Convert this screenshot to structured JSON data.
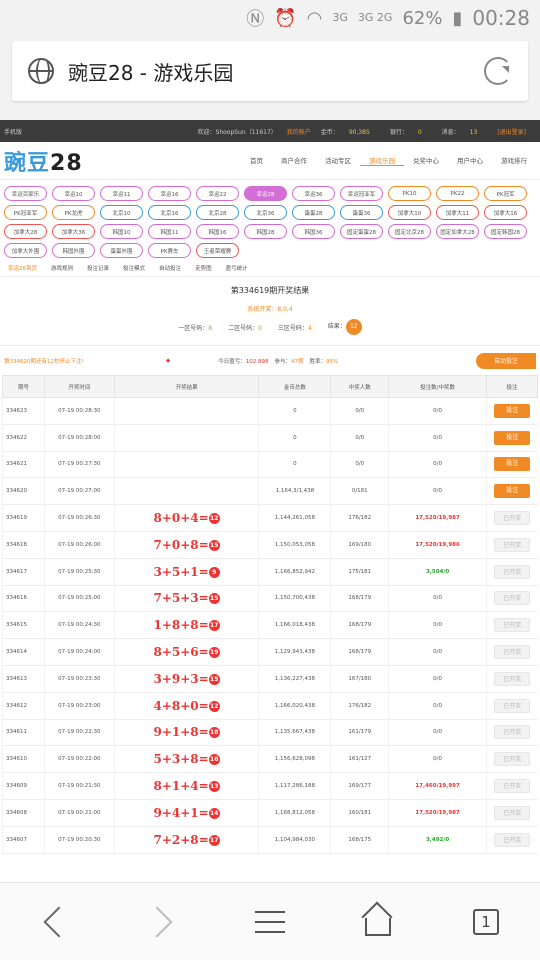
{
  "status": {
    "net1": "3G",
    "net2": "3G 2G",
    "battery": "62%",
    "time": "00:28"
  },
  "browser": {
    "title": "豌豆28 - 游戏乐园",
    "tabs_count": "1"
  },
  "topbar": {
    "left": "手机版",
    "user": "欢迎：ShoopSun（11617）",
    "my_account": "我的账户",
    "gold_label": "金币：",
    "gold_value": "90,385",
    "bank_label": "银行：",
    "bank_value": "0",
    "msg_label": "消息：",
    "msg_value": "13",
    "logout": "[退出登录]"
  },
  "logo": {
    "a": "豌豆",
    "b": "28"
  },
  "nav": [
    "首页",
    "商户合作",
    "活动专区",
    "游戏乐园",
    "兑奖中心",
    "用户中心",
    "游戏排行"
  ],
  "game_tags": [
    {
      "label": "幸运百家乐",
      "c": "p"
    },
    {
      "label": "幸运10",
      "c": "p"
    },
    {
      "label": "幸运11",
      "c": "p"
    },
    {
      "label": "幸运16",
      "c": "p"
    },
    {
      "label": "幸运22",
      "c": "p"
    },
    {
      "label": "幸运28",
      "c": "active"
    },
    {
      "label": "幸运36",
      "c": "p"
    },
    {
      "label": "幸运冠亚军",
      "c": "p"
    },
    {
      "label": "PK10",
      "c": "o"
    },
    {
      "label": "PK22",
      "c": "o"
    },
    {
      "label": "PK冠军",
      "c": "o"
    },
    {
      "label": "PK冠亚军",
      "c": "o"
    },
    {
      "label": "PK龙虎",
      "c": "o"
    },
    {
      "label": "北京10",
      "c": "b"
    },
    {
      "label": "北京16",
      "c": "b"
    },
    {
      "label": "北京28",
      "c": "b"
    },
    {
      "label": "北京36",
      "c": "b"
    },
    {
      "label": "蛋蛋28",
      "c": "b"
    },
    {
      "label": "蛋蛋36",
      "c": "b"
    },
    {
      "label": "加拿大10",
      "c": "r"
    },
    {
      "label": "加拿大11",
      "c": "r"
    },
    {
      "label": "加拿大16",
      "c": "r"
    },
    {
      "label": "加拿大28",
      "c": "r"
    },
    {
      "label": "加拿大36",
      "c": "r"
    },
    {
      "label": "韩国10",
      "c": "p"
    },
    {
      "label": "韩国11",
      "c": "p"
    },
    {
      "label": "韩国16",
      "c": "p"
    },
    {
      "label": "韩国28",
      "c": "p"
    },
    {
      "label": "韩国36",
      "c": "p"
    },
    {
      "label": "固定蛋蛋28",
      "c": "p"
    },
    {
      "label": "固定北京28",
      "c": "p"
    },
    {
      "label": "固定加拿大28",
      "c": "p"
    },
    {
      "label": "固定韩国28",
      "c": "p"
    },
    {
      "label": "加拿大外围",
      "c": "p"
    },
    {
      "label": "韩国外围",
      "c": "p"
    },
    {
      "label": "蛋蛋外围",
      "c": "p"
    },
    {
      "label": "PK赛车",
      "c": "p"
    },
    {
      "label": "王者荣耀赛",
      "c": "r"
    }
  ],
  "subtabs": [
    "幸运28首页",
    "游戏规则",
    "投注记录",
    "投注模式",
    "自动投注",
    "走势图",
    "盈亏统计"
  ],
  "result": {
    "title": "第334619期开奖结果",
    "status": "系统开奖：8,0,4",
    "zone1_label": "一区号码：",
    "zone1": "8",
    "zone2_label": "二区号码：",
    "zone2": "0",
    "zone3_label": "三区号码：",
    "zone3": "4",
    "result_label": "结果：",
    "result": "12"
  },
  "info": {
    "period_text": "第334620期还有12秒停止下注!",
    "today_label": "今日盈亏：",
    "today_value": "102,898",
    "join_label": "参与：",
    "join_value": "47期",
    "rate_label": "胜率：",
    "rate_value": "95%",
    "auto_btn": "自动投注"
  },
  "table": {
    "headers": [
      "期号",
      "开奖时间",
      "开奖结果",
      "金币总数",
      "中奖人数",
      "投注数/中奖数",
      "投注"
    ],
    "rows": [
      {
        "id": "334623",
        "time": "07-19 00:28:30",
        "expr": "",
        "res": "",
        "total": "0",
        "winners": "0/0",
        "bets": "0/0",
        "betc": "",
        "action": "投注",
        "act": "bet"
      },
      {
        "id": "334622",
        "time": "07-19 00:28:00",
        "expr": "",
        "res": "",
        "total": "0",
        "winners": "0/0",
        "bets": "0/0",
        "betc": "",
        "action": "投注",
        "act": "bet"
      },
      {
        "id": "334621",
        "time": "07-19 00:27:30",
        "expr": "",
        "res": "",
        "total": "0",
        "winners": "0/0",
        "bets": "0/0",
        "betc": "",
        "action": "投注",
        "act": "bet"
      },
      {
        "id": "334620",
        "time": "07-19 00:27:00",
        "expr": "",
        "res": "",
        "total": "1,164,3/1,438",
        "winners": "0/181",
        "bets": "0/0",
        "betc": "",
        "action": "投注",
        "act": "bet"
      },
      {
        "id": "334619",
        "time": "07-19 00:26:30",
        "expr": "8+0+4=",
        "res": "12",
        "total": "1,144,261,058",
        "winners": "176/182",
        "bets": "17,520/19,987",
        "betc": "r",
        "action": "已开奖",
        "act": "done"
      },
      {
        "id": "334618",
        "time": "07-19 00:26:00",
        "expr": "7+0+8=",
        "res": "15",
        "total": "1,150,053,058",
        "winners": "169/180",
        "bets": "17,520/19,986",
        "betc": "r",
        "action": "已开奖",
        "act": "done"
      },
      {
        "id": "334617",
        "time": "07-19 00:25:30",
        "expr": "3+5+1=",
        "res": "9",
        "total": "1,166,852,942",
        "winners": "175/181",
        "bets": "3,504/0",
        "betc": "g",
        "action": "已开奖",
        "act": "done"
      },
      {
        "id": "334616",
        "time": "07-19 00:25:00",
        "expr": "7+5+3=",
        "res": "15",
        "total": "1,150,700,438",
        "winners": "168/179",
        "bets": "0/0",
        "betc": "",
        "action": "已开奖",
        "act": "done"
      },
      {
        "id": "334615",
        "time": "07-19 00:24:30",
        "expr": "1+8+8=",
        "res": "17",
        "total": "1,166,018,438",
        "winners": "168/179",
        "bets": "0/0",
        "betc": "",
        "action": "已开奖",
        "act": "done"
      },
      {
        "id": "334614",
        "time": "07-19 00:24:00",
        "expr": "8+5+6=",
        "res": "19",
        "total": "1,129,943,438",
        "winners": "168/179",
        "bets": "0/0",
        "betc": "",
        "action": "已开奖",
        "act": "done"
      },
      {
        "id": "334613",
        "time": "07-19 00:23:30",
        "expr": "3+9+3=",
        "res": "15",
        "total": "1,136,227,438",
        "winners": "167/180",
        "bets": "0/0",
        "betc": "",
        "action": "已开奖",
        "act": "done"
      },
      {
        "id": "334612",
        "time": "07-19 00:23:00",
        "expr": "4+8+0=",
        "res": "12",
        "total": "1,166,020,438",
        "winners": "176/182",
        "bets": "0/0",
        "betc": "",
        "action": "已开奖",
        "act": "done"
      },
      {
        "id": "334611",
        "time": "07-19 00:22:30",
        "expr": "9+1+8=",
        "res": "18",
        "total": "1,135,667,438",
        "winners": "161/179",
        "bets": "0/0",
        "betc": "",
        "action": "已开奖",
        "act": "done"
      },
      {
        "id": "334610",
        "time": "07-19 00:22:00",
        "expr": "5+3+8=",
        "res": "16",
        "total": "1,156,628,098",
        "winners": "161/127",
        "bets": "0/0",
        "betc": "",
        "action": "已开奖",
        "act": "done"
      },
      {
        "id": "334609",
        "time": "07-19 00:21:30",
        "expr": "8+1+4=",
        "res": "13",
        "total": "1,117,286,188",
        "winners": "169/177",
        "bets": "17,460/19,997",
        "betc": "r",
        "action": "已开奖",
        "act": "done"
      },
      {
        "id": "334608",
        "time": "07-19 00:21:00",
        "expr": "9+4+1=",
        "res": "14",
        "total": "1,168,812,058",
        "winners": "160/181",
        "bets": "17,520/19,987",
        "betc": "r",
        "action": "已开奖",
        "act": "done"
      },
      {
        "id": "334607",
        "time": "07-19 00:20:30",
        "expr": "7+2+8=",
        "res": "17",
        "total": "1,104,984,030",
        "winners": "168/175",
        "bets": "3,492/0",
        "betc": "g",
        "action": "已开奖",
        "act": "done"
      }
    ]
  }
}
